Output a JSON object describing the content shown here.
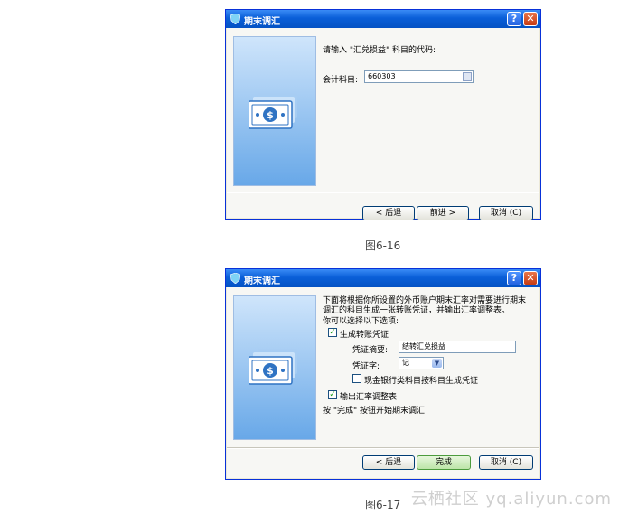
{
  "dialog1": {
    "title": "期末调汇",
    "prompt": "请输入 \"汇兑损益\" 科目的代码:",
    "account_label": "会计科目:",
    "account_value": "660303",
    "buttons": {
      "back": "< 后退",
      "next": "前进 >",
      "cancel": "取消 (C)"
    }
  },
  "caption1": "图6-16",
  "dialog2": {
    "title": "期末调汇",
    "desc_line1": "下面将根据你所设置的外币账户期末汇率对需要进行期末",
    "desc_line2": "调汇的科目生成一张转账凭证，并输出汇率调整表。",
    "options_intro": "你可以选择以下选项:",
    "gen_voucher_label": "生成转账凭证",
    "gen_voucher_checked": true,
    "summary_label": "凭证摘要:",
    "summary_value": "结转汇兑损益",
    "voucher_word_label": "凭证字:",
    "voucher_word_value": "记",
    "cash_bank_label": "现金银行类科目按科目生成凭证",
    "cash_bank_checked": false,
    "output_table_label": "输出汇率调整表",
    "output_table_checked": true,
    "finish_hint": "按 \"完成\" 按钮开始期末调汇",
    "buttons": {
      "back": "< 后退",
      "finish": "完成",
      "cancel": "取消 (C)"
    }
  },
  "caption2": "图6-17",
  "watermark": "云栖社区 yq.aliyun.com"
}
